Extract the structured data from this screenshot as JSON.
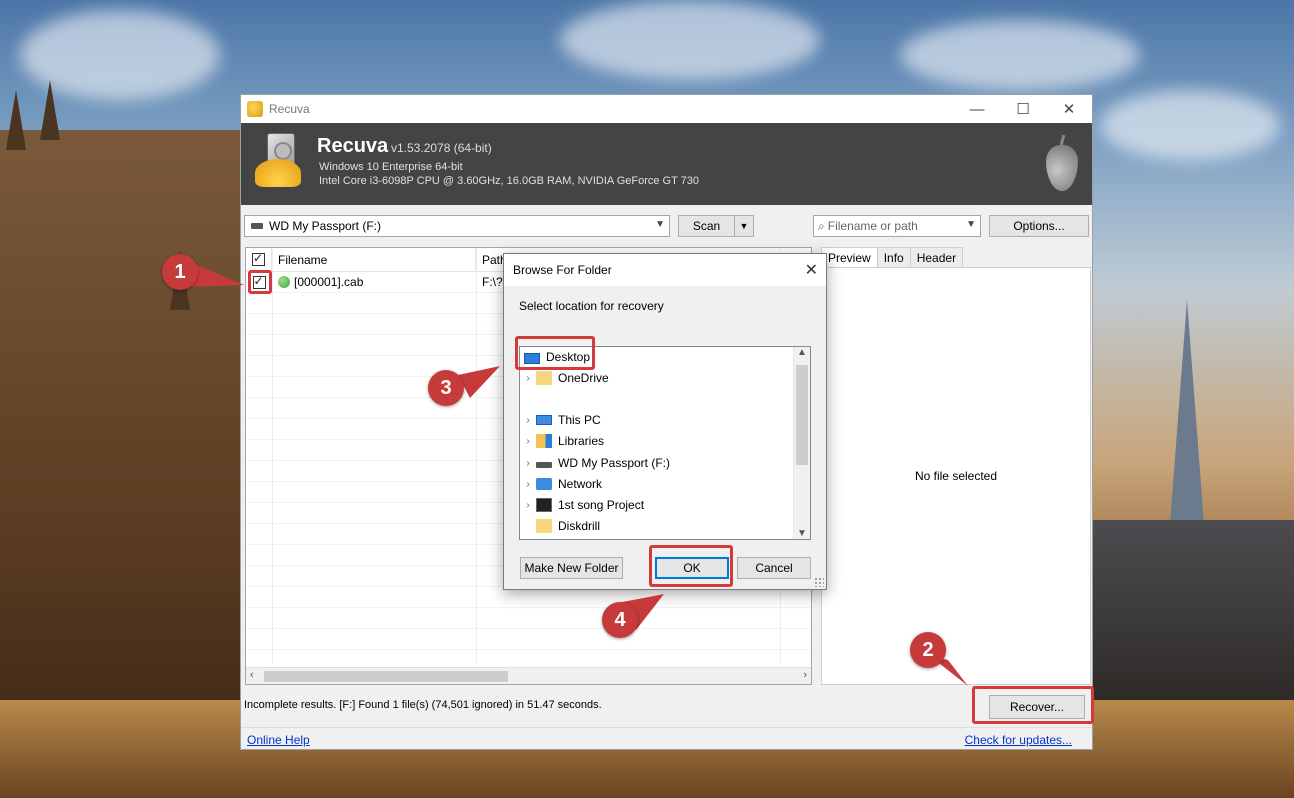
{
  "window": {
    "title": "Recuva",
    "controls": {
      "minimize": "—",
      "maximize": "☐",
      "close": "✕"
    }
  },
  "header": {
    "app_name": "Recuva",
    "version": "v1.53.2078 (64-bit)",
    "os": "Windows 10 Enterprise 64-bit",
    "hardware": "Intel Core i3-6098P CPU @ 3.60GHz, 16.0GB RAM, NVIDIA GeForce GT 730"
  },
  "toolbar": {
    "drive": "WD My Passport (F:)",
    "scan_label": "Scan",
    "filter_placeholder": "Filename or path",
    "options_label": "Options..."
  },
  "filelist": {
    "columns": [
      "Filename",
      "Path"
    ],
    "rows": [
      {
        "name": "[000001].cab",
        "path": "F:\\?\\",
        "checked": true,
        "state": "green"
      }
    ]
  },
  "preview": {
    "tabs": [
      "Preview",
      "Info",
      "Header"
    ],
    "active_tab": "Preview",
    "empty_text": "No file selected"
  },
  "status": {
    "text": "Incomplete results. [F:] Found 1 file(s) (74,501 ignored) in 51.47 seconds.",
    "recover_label": "Recover...",
    "online_help": "Online Help",
    "check_updates": "Check for updates..."
  },
  "dialog": {
    "title": "Browse For Folder",
    "prompt": "Select location for recovery",
    "tree": [
      {
        "label": "Desktop",
        "icon": "desktop-icon",
        "expandable": false,
        "selected": true
      },
      {
        "label": "OneDrive",
        "icon": "folder-icon",
        "expandable": true
      },
      {
        "label": "This PC",
        "icon": "computer-icon",
        "expandable": true
      },
      {
        "label": "Libraries",
        "icon": "libraries-icon",
        "expandable": true
      },
      {
        "label": "WD My Passport (F:)",
        "icon": "drive-icon",
        "expandable": true
      },
      {
        "label": "Network",
        "icon": "network-icon",
        "expandable": true
      },
      {
        "label": "1st song Project",
        "icon": "project-icon",
        "expandable": true
      },
      {
        "label": "Diskdrill",
        "icon": "folder-icon",
        "expandable": false
      }
    ],
    "make_folder_label": "Make New Folder",
    "ok_label": "OK",
    "cancel_label": "Cancel"
  },
  "annotations": {
    "step1": "1",
    "step2": "2",
    "step3": "3",
    "step4": "4",
    "highlight_color": "#d33b3b"
  }
}
